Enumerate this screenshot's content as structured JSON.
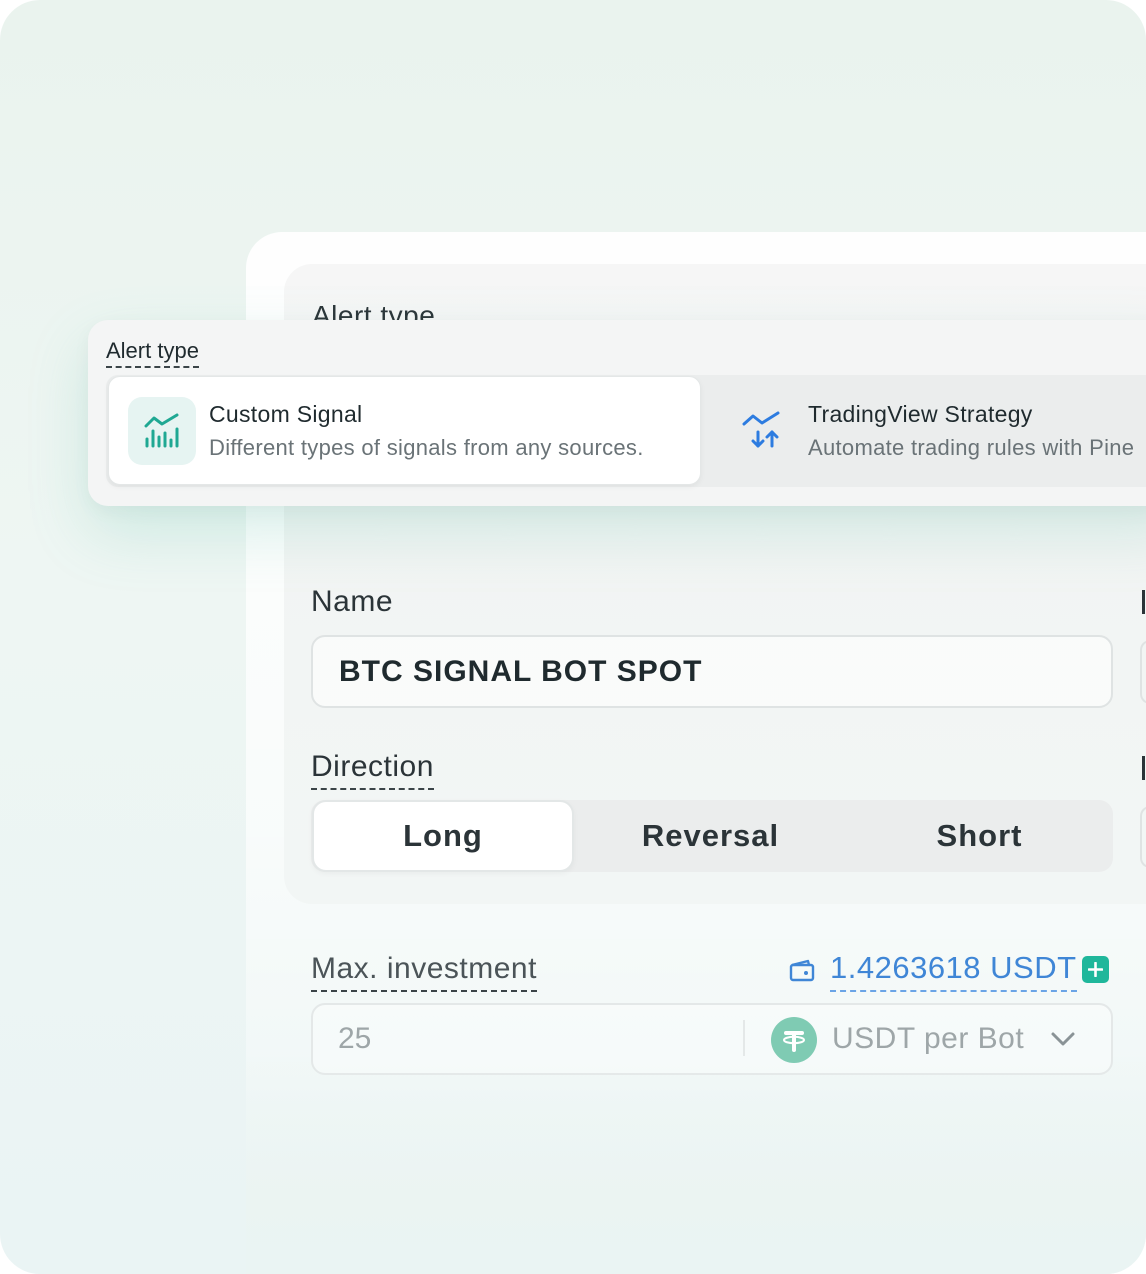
{
  "alert_type": {
    "ghost_label": "Alert type",
    "label": "Alert type",
    "options": [
      {
        "title": "Custom Signal",
        "description": "Different types of signals from any sources.",
        "icon": "signal-chart-icon",
        "selected": true
      },
      {
        "title": "TradingView Strategy",
        "description": "Automate trading rules with Pine",
        "icon": "tradingview-strategy-icon",
        "selected": false
      }
    ]
  },
  "name": {
    "label": "Name",
    "value": "BTC SIGNAL BOT SPOT"
  },
  "direction": {
    "label": "Direction",
    "options": [
      "Long",
      "Reversal",
      "Short"
    ],
    "selected": "Long"
  },
  "investment": {
    "label": "Max. investment",
    "balance": "1.4263618 USDT",
    "value": "25",
    "unit": "USDT per Bot",
    "currency_icon": "usdt-icon"
  },
  "colors": {
    "accent": "#1fb79b",
    "link": "#3f86d6",
    "usdt": "#7fcbb3"
  }
}
